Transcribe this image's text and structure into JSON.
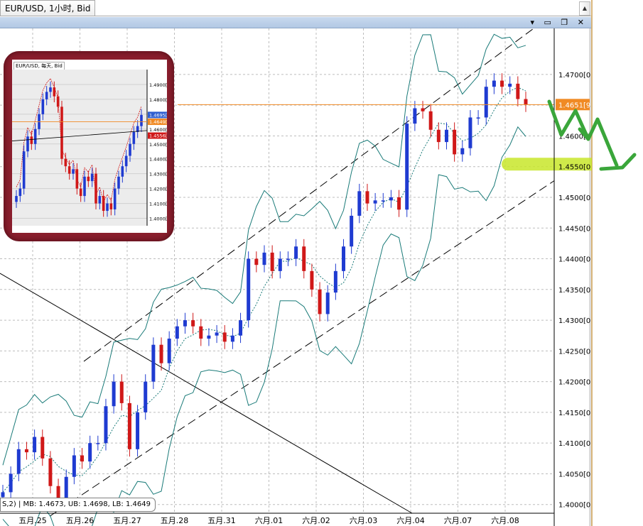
{
  "window": {
    "tab_title": "EUR/USD, 1小时, Bid"
  },
  "legend_text": "S,2) | MB: 1.4673, UB: 1.4698, LB: 1.4649",
  "current_price_label": "1.4651[9",
  "highlight_level_label": "1.4550[0",
  "inset": {
    "title": "EUR/USD, 每天, Bid"
  },
  "colors": {
    "up": "#1f3bd1",
    "down": "#d01818",
    "band": "#197a78",
    "grid": "#b9b9b9",
    "price_line": "#f08a24",
    "highlight": "#c8e62a",
    "frame": "#8b1f2e",
    "arrow": "#3aa63a"
  },
  "chart_data": [
    {
      "type": "candlestick",
      "title": "",
      "y_ticks": [
        "1.4000[0",
        "1.4050[0",
        "1.4100[0",
        "1.4150[0",
        "1.4200[0",
        "1.4250[0",
        "1.4300[0",
        "1.4350[0",
        "1.4400[0",
        "1.4450[0",
        "1.4500[0",
        "1.4550[0",
        "1.4600[0",
        "1.4650[0",
        "1.4700[0"
      ],
      "x_ticks": [
        "五月.25",
        "五月.26",
        "五月.27",
        "五月.28",
        "五月.31",
        "六月.01",
        "六月.02",
        "六月.03",
        "六月.04",
        "六月.07",
        "六月.08"
      ],
      "ylim": [
        1.3965,
        1.4775
      ],
      "overlay": "Bollinger bands (MB, UB, LB)",
      "last_price": 1.4651,
      "close_path": [
        [
          1.402,
          1.405,
          1.409,
          1.4085,
          1.411,
          1.4075,
          1.403,
          1.401,
          1.4045,
          1.408,
          1.407,
          1.41
        ],
        [
          1.41,
          1.416,
          1.42,
          1.4165,
          1.409,
          1.415,
          1.42,
          1.426,
          1.423,
          1.427,
          1.429,
          1.43
        ],
        [
          1.429,
          1.427,
          1.4275,
          1.428,
          1.4265,
          1.4275,
          1.43,
          1.44,
          1.439,
          1.441,
          1.438,
          1.44
        ],
        [
          1.44,
          1.442,
          1.438,
          1.435,
          1.431,
          1.4345,
          1.438,
          1.442,
          1.447,
          1.451,
          1.449,
          1.4495
        ],
        [
          1.4495,
          1.45,
          1.448,
          1.462,
          1.4645,
          1.464,
          1.461,
          1.459,
          1.461,
          1.457,
          1.458,
          1.463
        ],
        [
          1.463,
          1.468,
          1.469,
          1.468,
          1.4685,
          1.466,
          1.4651
        ]
      ],
      "channel": {
        "upper": [
          [
            1.4233,
            1.4774
          ]
        ],
        "lower": [
          [
            1.3981,
            1.4527
          ]
        ]
      }
    },
    {
      "type": "candlestick",
      "title": "EUR/USD, 每天, Bid",
      "y_ticks": [
        "1.4000[0",
        "1.4100[0",
        "1.4200[0",
        "1.4300[0",
        "1.4400[0",
        "1.4500[0",
        "1.4600[0",
        "1.4700[0",
        "1.4800[0",
        "1.4900[0"
      ],
      "price_labels": [
        "1.4695[5",
        "1.4649[5",
        "1.4556[5"
      ],
      "ylim": [
        1.395,
        1.5
      ],
      "closes": [
        1.415,
        1.42,
        1.445,
        1.455,
        1.45,
        1.46,
        1.47,
        1.48,
        1.485,
        1.488,
        1.482,
        1.475,
        1.44,
        1.435,
        1.43,
        1.433,
        1.42,
        1.415,
        1.428,
        1.425,
        1.43,
        1.41,
        1.415,
        1.405,
        1.41,
        1.406,
        1.42,
        1.428,
        1.435,
        1.442,
        1.45,
        1.458,
        1.462,
        1.4695
      ]
    }
  ]
}
